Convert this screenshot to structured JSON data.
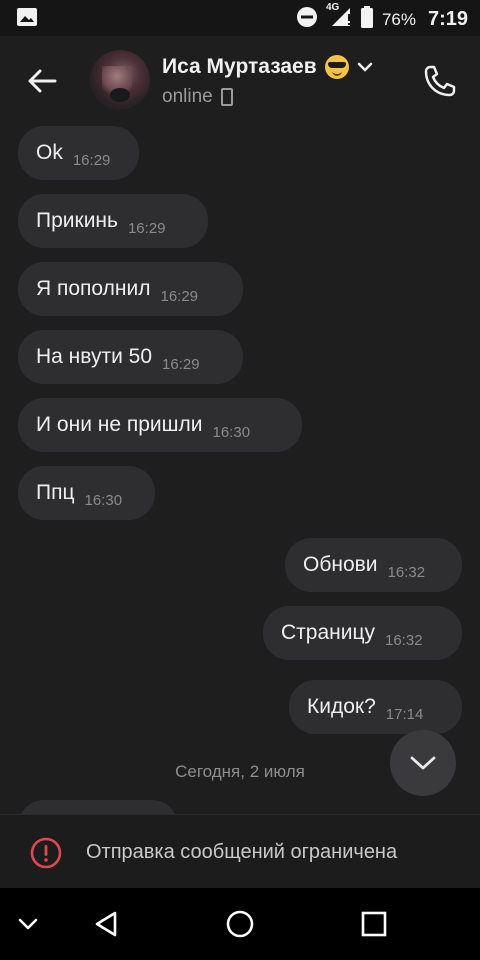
{
  "status_bar": {
    "network": "4G",
    "battery": "76%",
    "time": "7:19",
    "icons": [
      "image-icon",
      "do-not-disturb-icon",
      "signal-icon",
      "battery-icon"
    ]
  },
  "header": {
    "contact_name": "Иса Муртазаев",
    "status": "online",
    "icons": [
      "back-arrow-icon",
      "avatar",
      "sunglasses-emoji-icon",
      "chevron-down-icon",
      "mobile-device-icon",
      "phone-call-icon"
    ]
  },
  "messages": [
    {
      "text": "Ok",
      "time": "16:29",
      "side": "incoming"
    },
    {
      "text": "Прикинь",
      "time": "16:29",
      "side": "incoming"
    },
    {
      "text": "Я пополнил",
      "time": "16:29",
      "side": "incoming"
    },
    {
      "text": "На нвути 50",
      "time": "16:29",
      "side": "incoming"
    },
    {
      "text": "И они не пришли",
      "time": "16:30",
      "side": "incoming"
    },
    {
      "text": "Ппц",
      "time": "16:30",
      "side": "incoming"
    },
    {
      "text": "Обнови",
      "time": "16:32",
      "side": "outgoing"
    },
    {
      "text": "Страницу",
      "time": "16:32",
      "side": "outgoing"
    },
    {
      "text": "Кидок?",
      "time": "17:14",
      "side": "outgoing"
    }
  ],
  "date_separator": "Сегодня, 2 июля",
  "banner": {
    "text": "Отправка сообщений ограничена",
    "icon": "alert-circle-icon",
    "accent_color": "#e0484e"
  },
  "nav": {
    "icons": [
      "chevron-down-icon",
      "back-triangle-icon",
      "home-circle-icon",
      "recents-square-icon"
    ]
  },
  "colors": {
    "background": "#1e1e1f",
    "bubble": "#2e2e30"
  }
}
